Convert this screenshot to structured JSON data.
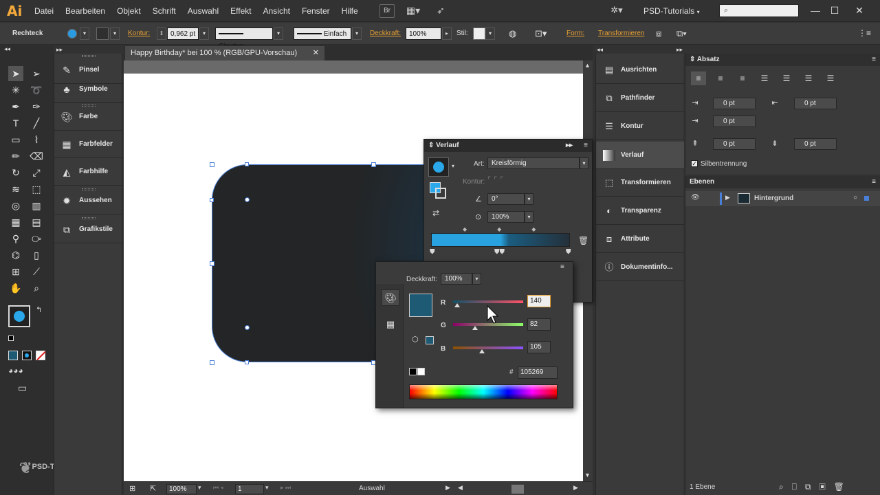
{
  "app": {
    "logo": "Ai",
    "menu": [
      "Datei",
      "Bearbeiten",
      "Objekt",
      "Schrift",
      "Auswahl",
      "Effekt",
      "Ansicht",
      "Fenster",
      "Hilfe"
    ],
    "bridge_label": "Br",
    "workspace": "PSD-Tutorials",
    "search_placeholder": ""
  },
  "control_bar": {
    "object_type": "Rechteck",
    "kontur_label": "Kontur:",
    "kontur_value": "0,962 pt",
    "stroke_profile": "Gleichm.",
    "brush": "Einfach",
    "deckkraft_label": "Deckkraft:",
    "deckkraft_value": "100%",
    "stil_label": "Stil:",
    "form_label": "Form:",
    "transform_label": "Transformieren"
  },
  "document": {
    "tab_title": "Happy Birthday* bei 100 % (RGB/GPU-Vorschau)",
    "zoom": "100%",
    "artboard": "1",
    "status": "Auswahl"
  },
  "left_panels": [
    {
      "label": "Pinsel",
      "icon": "brush-icon"
    },
    {
      "label": "Symbole",
      "icon": "club-icon"
    },
    {
      "label": "Farbe",
      "icon": "palette-icon"
    },
    {
      "label": "Farbfelder",
      "icon": "grid-icon"
    },
    {
      "label": "Farbhilfe",
      "icon": "color-guide-icon"
    },
    {
      "label": "Aussehen",
      "icon": "sun-icon"
    },
    {
      "label": "Grafikstile",
      "icon": "graphic-styles-icon"
    }
  ],
  "right_panels": [
    {
      "label": "Ausrichten",
      "icon": "align-icon"
    },
    {
      "label": "Pathfinder",
      "icon": "pathfinder-icon"
    },
    {
      "label": "Kontur",
      "icon": "stroke-icon"
    },
    {
      "label": "Verlauf",
      "icon": "gradient-icon"
    },
    {
      "label": "Transformieren",
      "icon": "transform-icon"
    },
    {
      "label": "Transparenz",
      "icon": "transparency-icon"
    },
    {
      "label": "Attribute",
      "icon": "attributes-icon"
    },
    {
      "label": "Dokumentinfo...",
      "icon": "info-icon"
    }
  ],
  "absatz": {
    "title": "Absatz",
    "indent_left": "0 pt",
    "indent_right": "0 pt",
    "first_line": "0 pt",
    "space_before": "0 pt",
    "space_after": "0 pt",
    "hyphenation_label": "Silbentrennung"
  },
  "ebenen": {
    "title": "Ebenen",
    "layer_name": "Hintergrund",
    "count": "1 Ebene"
  },
  "verlauf": {
    "title": "Verlauf",
    "art_label": "Art:",
    "art_value": "Kreisförmig",
    "kontur_label": "Kontur:",
    "angle": "0°",
    "aspect": "100%"
  },
  "farbe": {
    "deckkraft_label": "Deckkraft:",
    "deckkraft_value": "100%",
    "r_label": "R",
    "g_label": "G",
    "b_label": "B",
    "r": "140",
    "g": "82",
    "b": "105",
    "hex_label": "#",
    "hex": "105269",
    "swatch_color": "#1f5a74"
  },
  "watermark": "PSD-Tutorials.de"
}
